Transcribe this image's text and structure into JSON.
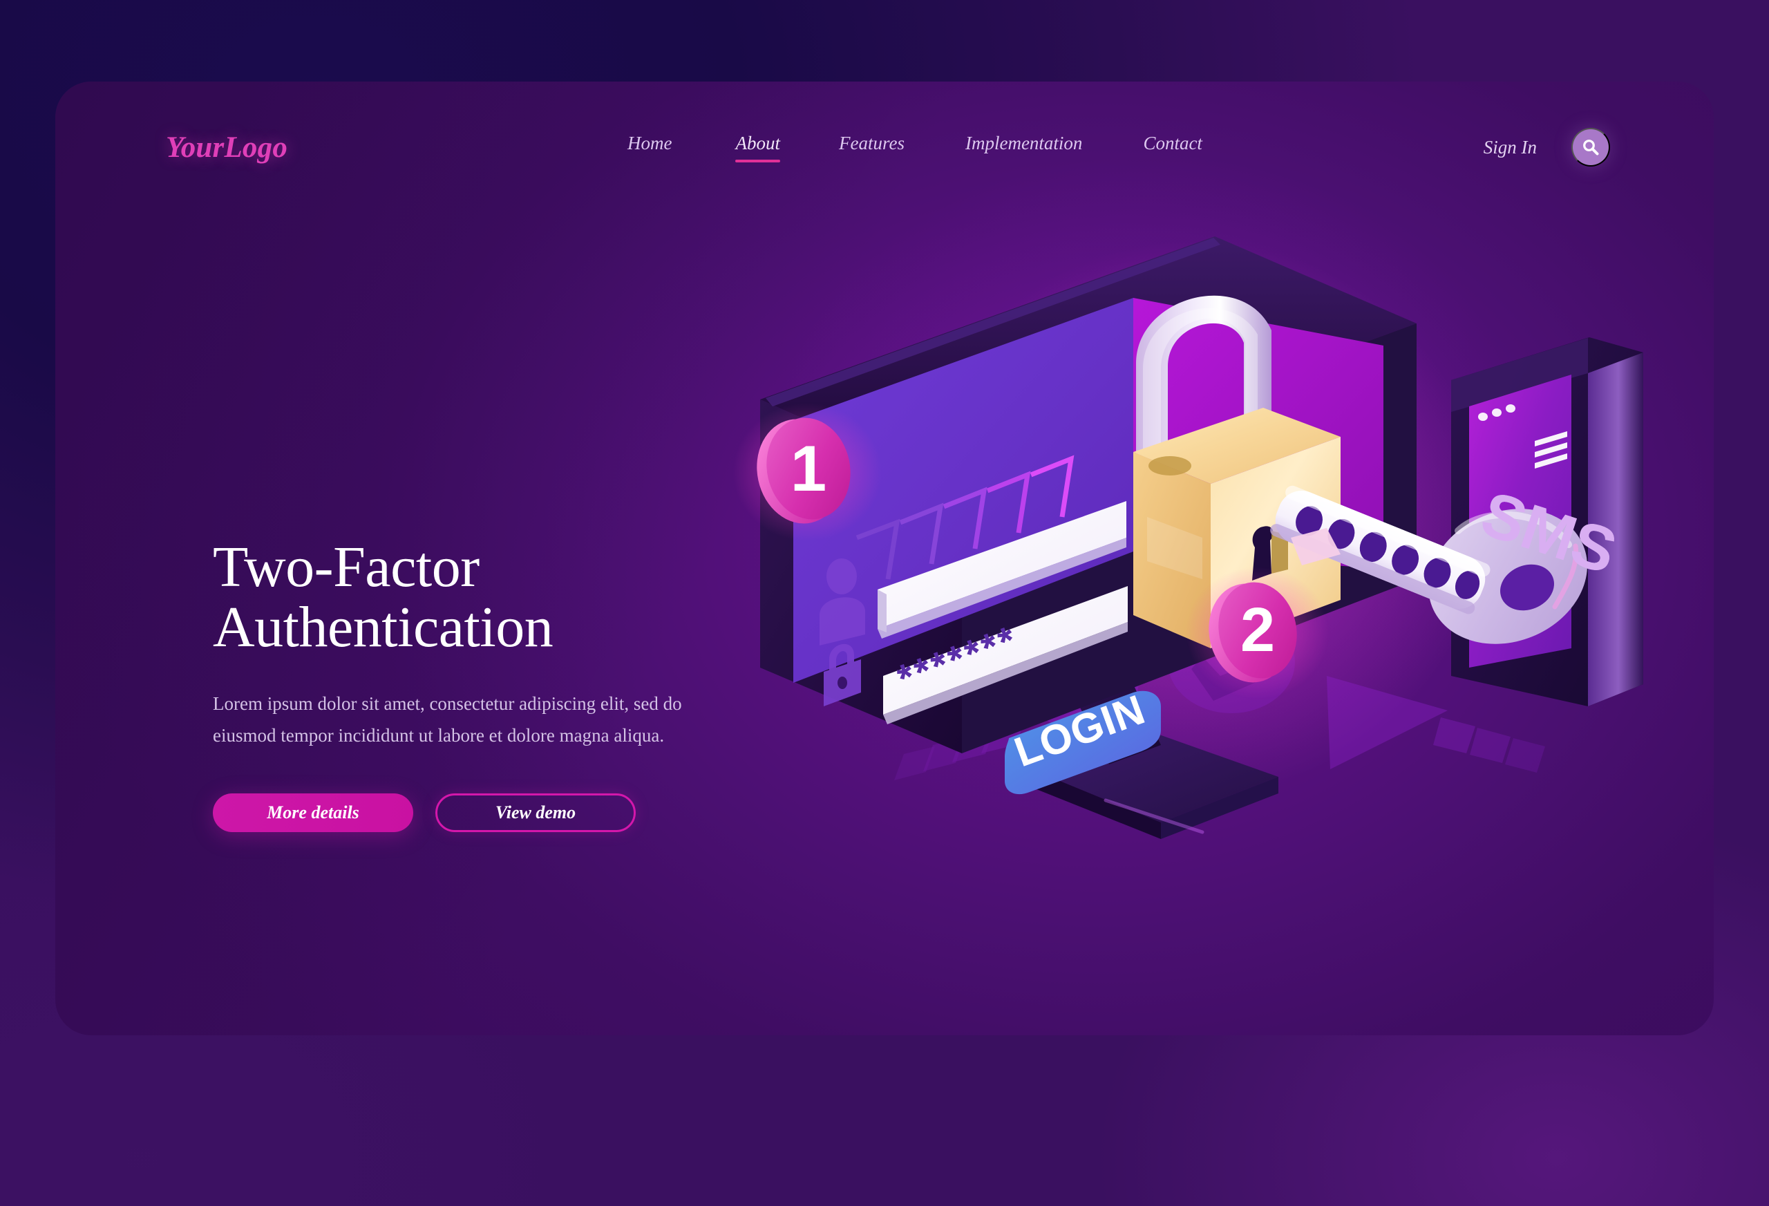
{
  "theme": {
    "page_background": "#190A47",
    "card_background": "#4B1072",
    "accent_pink": "#CD17A8",
    "accent_magenta": "#E03098",
    "logo_pink": "#E03FB8",
    "text_light": "#FFFFFF",
    "text_muted": "#D4C2E6",
    "login_button_blue": "#3E8EE0",
    "padlock_gold": "#F6D79A",
    "key_silver": "#CBB8E0"
  },
  "header": {
    "logo": "YourLogo",
    "nav": [
      {
        "label": "Home",
        "active": false
      },
      {
        "label": "About",
        "active": true
      },
      {
        "label": "Features",
        "active": false
      },
      {
        "label": "Implementation",
        "active": false
      },
      {
        "label": "Contact",
        "active": false
      }
    ],
    "signin_label": "Sign In",
    "search_icon": "search-icon"
  },
  "hero": {
    "title_line1": "Two-Factor",
    "title_line2": "Authentication",
    "subtitle": "Lorem ipsum dolor sit amet, consectetur adipiscing elit, sed do eiusmod tempor incididunt ut labore et dolore magna aliqua.",
    "primary_button": "More details",
    "secondary_button": "View demo"
  },
  "illustration": {
    "step_one_badge": "1",
    "step_two_badge": "2",
    "monitor": {
      "username_placeholder": "",
      "password_value": "*******",
      "login_button": "LOGIN",
      "user_icon": "user-icon",
      "lock_icon": "lock-icon",
      "chevron_count": 5
    },
    "phone": {
      "screen_label": "SMS",
      "menu_icon": "hamburger-menu-icon",
      "dots_icon": "three-dots-icon",
      "chat_icon": "chat-bubble-icon"
    },
    "key": {
      "hole_count": 6,
      "icon": "key-icon"
    },
    "padlock": {
      "icon": "padlock-icon"
    },
    "ground": {
      "check_icon": "check-circle-icon",
      "arrow_count": 2
    }
  }
}
